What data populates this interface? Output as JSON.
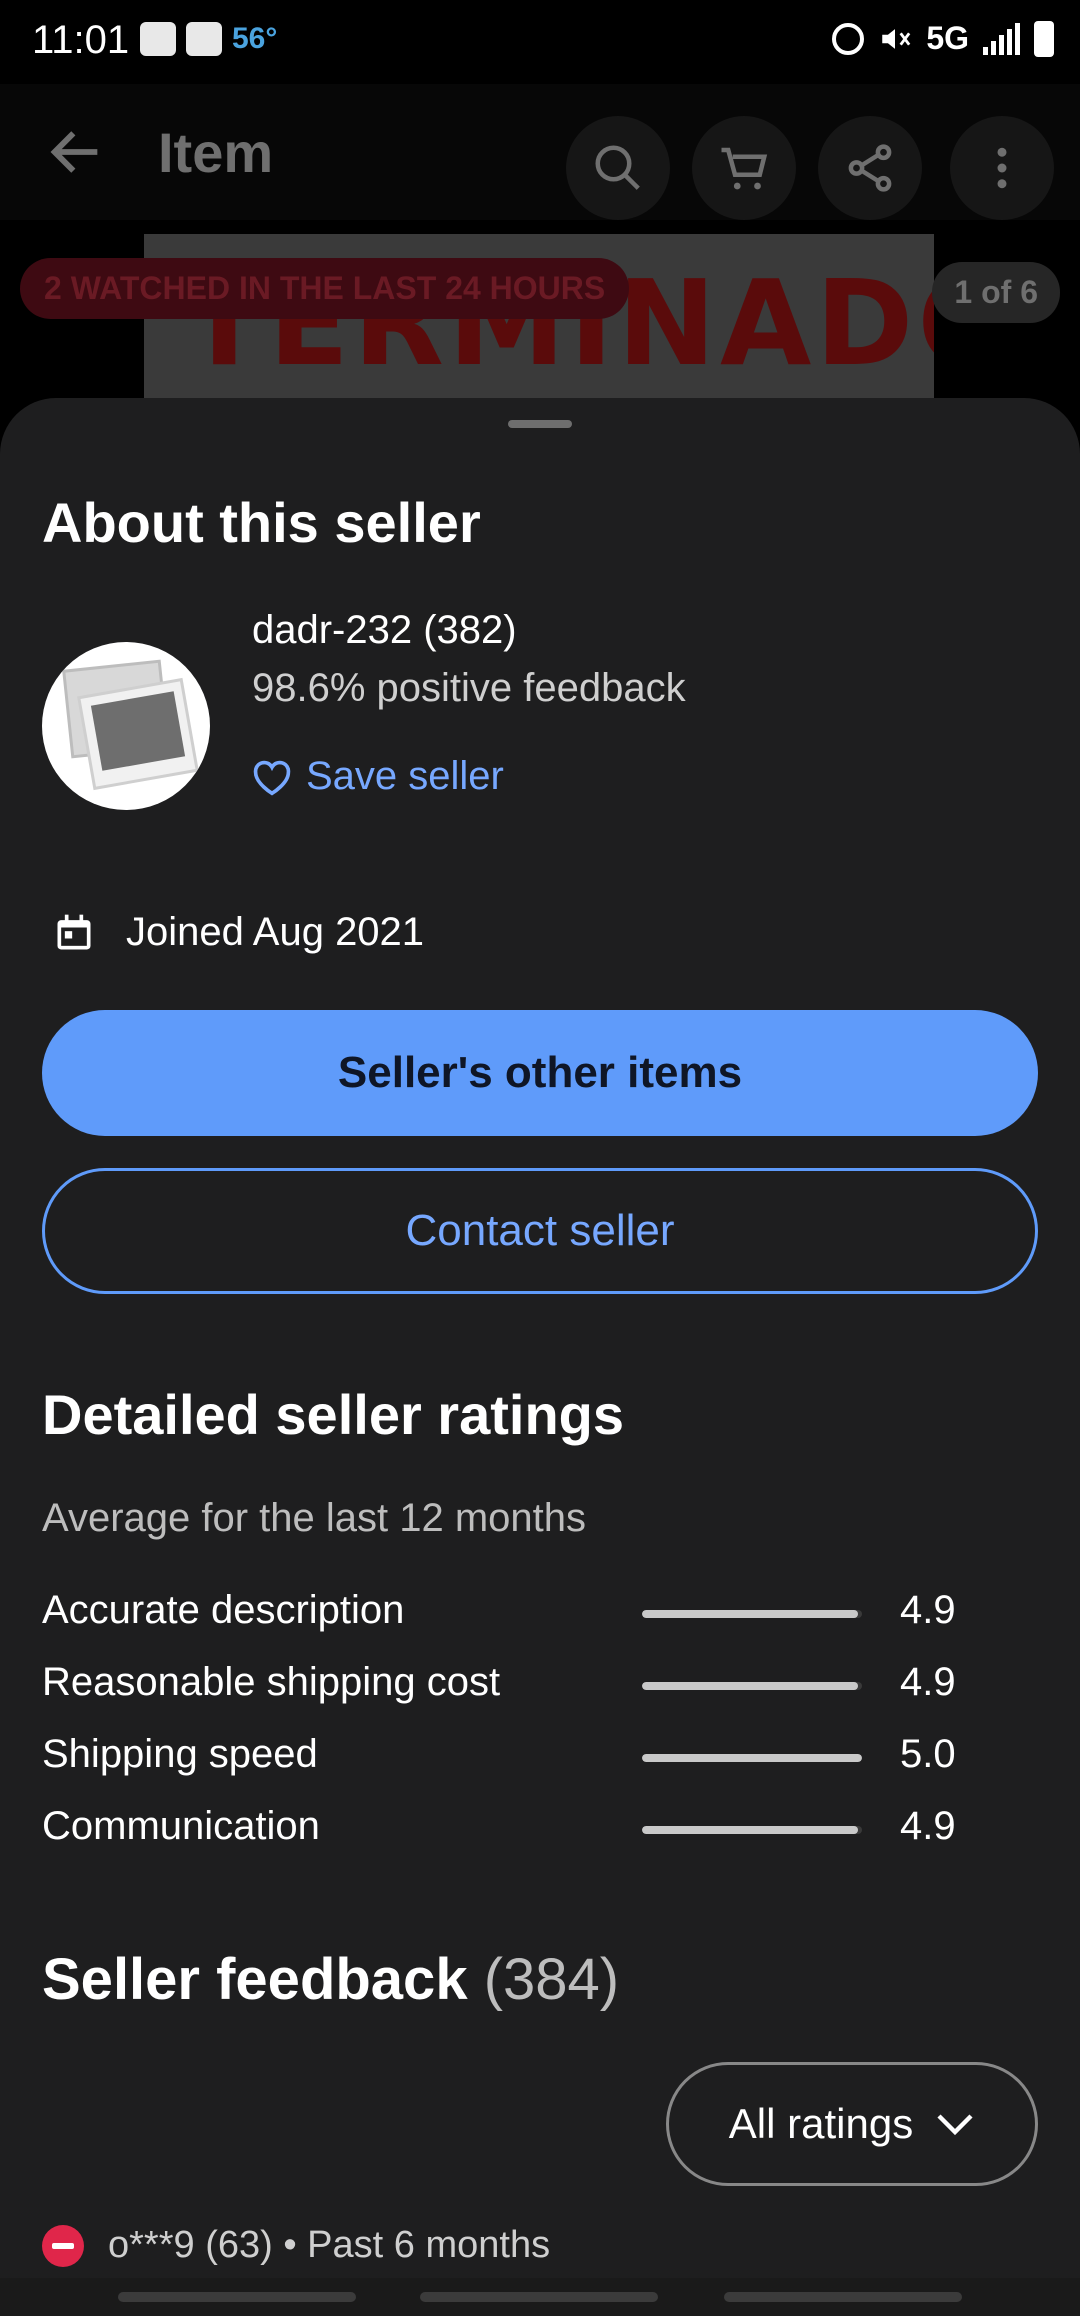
{
  "status_bar": {
    "time": "11:01",
    "temperature": "56°",
    "network": "5G"
  },
  "app_bar": {
    "title": "Item",
    "icons": [
      "back-arrow-icon",
      "search-icon",
      "cart-icon",
      "share-icon",
      "more-vert-icon"
    ]
  },
  "hero": {
    "image_text": "TERMINADOR",
    "watched_badge": "2 WATCHED IN THE LAST 24 HOURS",
    "image_counter": "1 of 6"
  },
  "seller": {
    "heading": "About this seller",
    "name": "dadr-232 (382)",
    "positive_feedback": "98.6% positive feedback",
    "save_label": "Save seller",
    "joined": "Joined Aug 2021",
    "other_items_label": "Seller's other items",
    "contact_label": "Contact seller"
  },
  "ratings": {
    "heading": "Detailed seller ratings",
    "subtitle": "Average for the last 12 months",
    "max_score": 5.0,
    "items": [
      {
        "label": "Accurate description",
        "score": "4.9",
        "value": 4.9
      },
      {
        "label": "Reasonable shipping cost",
        "score": "4.9",
        "value": 4.9
      },
      {
        "label": "Shipping speed",
        "score": "5.0",
        "value": 5.0
      },
      {
        "label": "Communication",
        "score": "4.9",
        "value": 4.9
      }
    ]
  },
  "feedback": {
    "heading": "Seller feedback",
    "count": "(384)",
    "filter_label": "All ratings",
    "first_entry": "o***9 (63) • Past 6 months"
  },
  "colors": {
    "accent": "#5f9bfa",
    "link": "#77a8ff",
    "sheet_background": "#1e1e1f",
    "negative": "#e0264a"
  }
}
